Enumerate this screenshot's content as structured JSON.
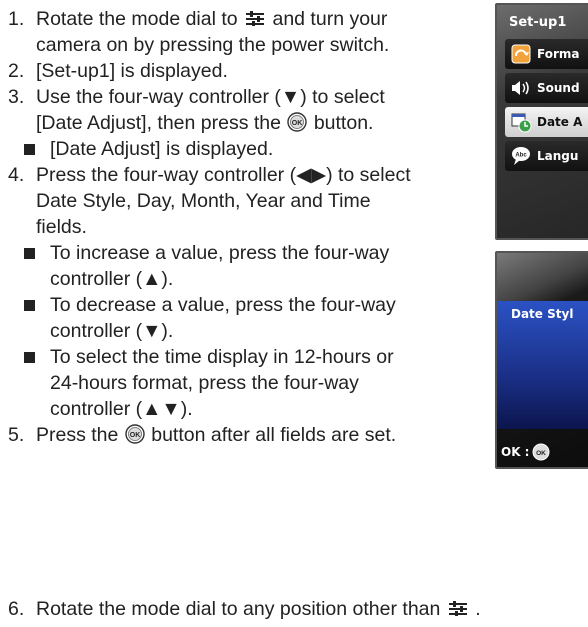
{
  "steps": [
    {
      "num": "1.",
      "pre": "Rotate the mode dial to",
      "post": "and turn your camera on by pressing the power switch."
    },
    {
      "num": "2.",
      "text": "[Set-up1] is displayed."
    },
    {
      "num": "3.",
      "pre": "Use the four-way controller (▼) to select [Date Adjust], then press the",
      "post": "button.",
      "subs": [
        "[Date Adjust] is displayed."
      ]
    },
    {
      "num": "4.",
      "text": "Press the four-way controller (◀▶) to select  Date Style, Day, Month, Year and Time fields.",
      "subs": [
        "To increase a value, press the four-way controller (▲).",
        "To decrease a value, press the four-way controller (▼).",
        "To select the time display in 12-hours or 24-hours format, press the four-way controller (▲▼)."
      ]
    },
    {
      "num": "5.",
      "pre": "Press the",
      "post": "button after all fields are set."
    },
    {
      "num": "6.",
      "pre": "Rotate the mode dial to any position other than",
      "post": "."
    }
  ],
  "icons": {
    "mode_dial": "setup-mode-icon",
    "ok_button": "ok-button-icon"
  },
  "screen_setup": {
    "title": "Set-up1",
    "items": [
      {
        "label": "Forma",
        "icon": "format-icon",
        "selected": false
      },
      {
        "label": "Sound",
        "icon": "sound-icon",
        "selected": false
      },
      {
        "label": "Date A",
        "icon": "date-adjust-icon",
        "selected": true
      },
      {
        "label": "Langu",
        "icon": "language-icon",
        "selected": false
      }
    ]
  },
  "screen_date": {
    "field_label": "Date Styl",
    "ok_label": "OK :",
    "ok_icon_text": "OK"
  },
  "colors": {
    "text": "#222222",
    "highlight_band": "#2b52c4",
    "menu_selected": "#e6e6e6"
  }
}
